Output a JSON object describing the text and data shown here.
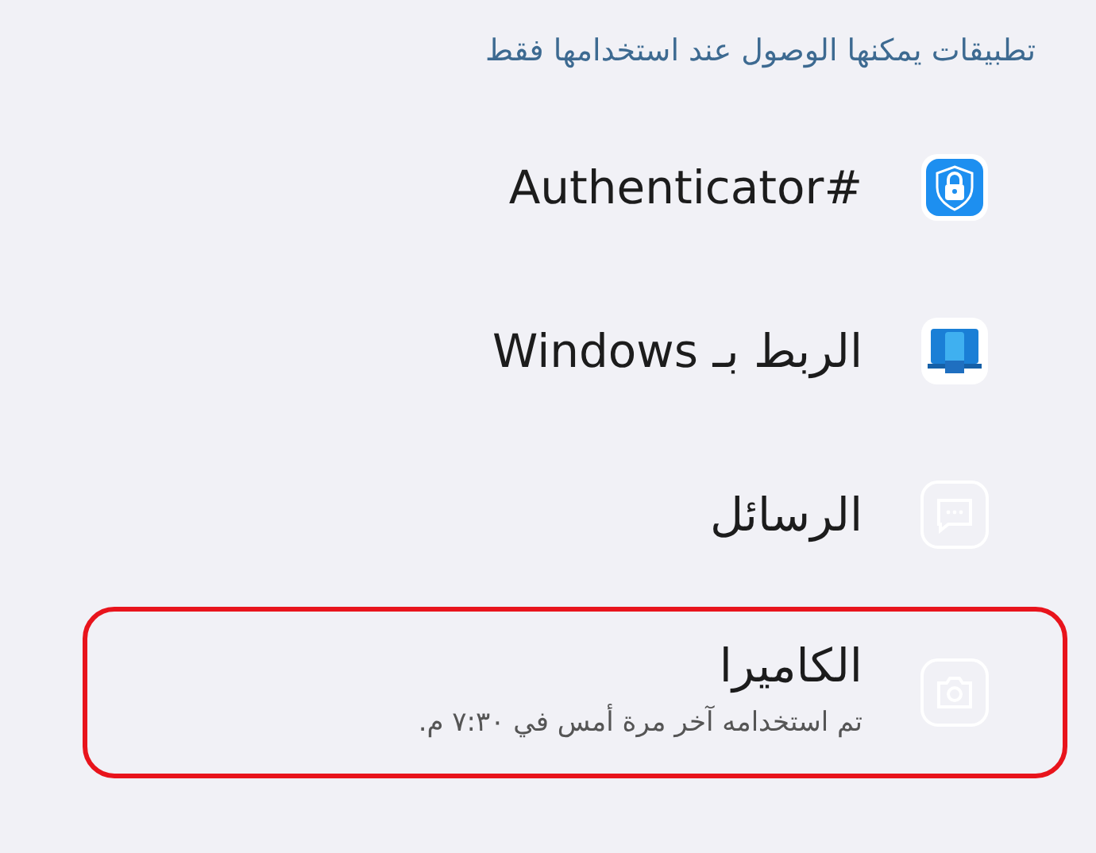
{
  "section_header": "تطبيقات يمكنها الوصول عند استخدامها فقط",
  "apps": [
    {
      "kind": "shield",
      "name": "#Authenticator",
      "highlighted": false
    },
    {
      "kind": "laptop",
      "name": "الربط بـ Windows",
      "highlighted": false
    },
    {
      "kind": "message",
      "name": "الرسائل",
      "highlighted": false
    },
    {
      "kind": "camera",
      "name": "الكاميرا",
      "subtitle": "تم استخدامه آخر مرة أمس في ٧:٣٠ م.",
      "highlighted": true
    }
  ]
}
